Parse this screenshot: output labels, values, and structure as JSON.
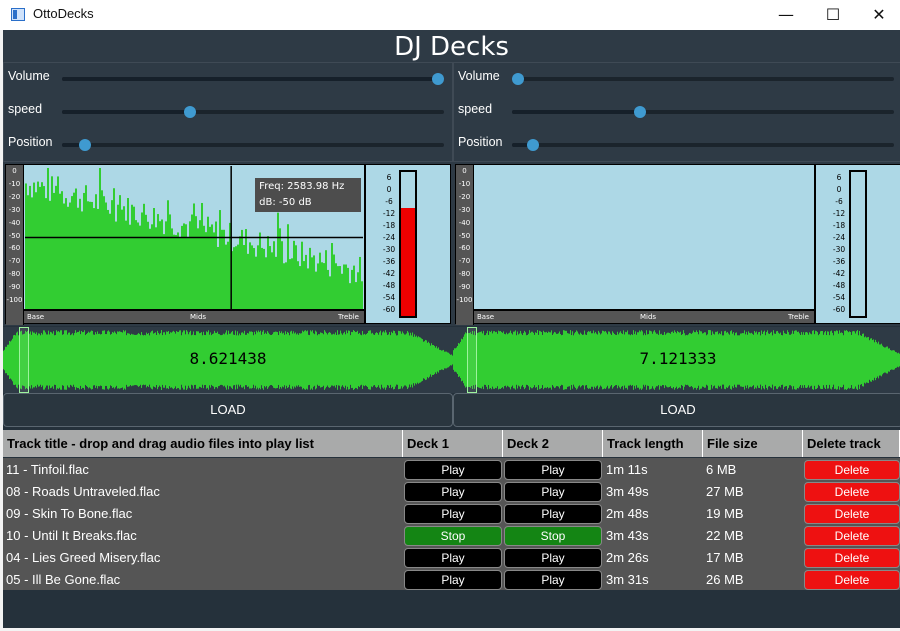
{
  "window": {
    "title": "OttoDecks",
    "minimize": "—",
    "maximize": "☐",
    "close": "✕"
  },
  "header": {
    "title": "DJ Decks"
  },
  "colors": {
    "background": "#25313b",
    "panel": "#2e3a45",
    "accent": "#3f9ad0",
    "waveform": "#32cd32",
    "spectrum_bg": "#add8e6",
    "meter": "#ee0000",
    "delete": "#ee1111",
    "stop": "#148514",
    "play": "#000000"
  },
  "deck_left": {
    "controls": [
      {
        "label": "Volume",
        "value": 1.0
      },
      {
        "label": "speed",
        "value": 0.33
      },
      {
        "label": "Position",
        "value": 0.045
      }
    ],
    "spectrum": {
      "db_ticks": [
        "0",
        "-10",
        "-20",
        "-30",
        "-40",
        "-50",
        "-60",
        "-70",
        "-80",
        "-90",
        "-100"
      ],
      "freq_labels": [
        "Base",
        "Mids",
        "Treble"
      ],
      "tooltip_freq": "Freq: 2583.98 Hz",
      "tooltip_db": "dB: -50 dB",
      "cursor": {
        "freq_fraction": 0.61,
        "db": -50
      },
      "show_bars": true
    },
    "meter": {
      "ticks": [
        "6",
        "0",
        "-6",
        "-12",
        "-18",
        "-24",
        "-30",
        "-36",
        "-42",
        "-48",
        "-54",
        "-60"
      ],
      "level_fraction": 0.75
    },
    "waveform": {
      "time": "8.621438",
      "position_fraction": 0.045
    },
    "load_label": "LOAD"
  },
  "deck_right": {
    "controls": [
      {
        "label": "Volume",
        "value": 0.0
      },
      {
        "label": "speed",
        "value": 0.33
      },
      {
        "label": "Position",
        "value": 0.04
      }
    ],
    "spectrum": {
      "db_ticks": [
        "0",
        "-10",
        "-20",
        "-30",
        "-40",
        "-50",
        "-60",
        "-70",
        "-80",
        "-90",
        "-100"
      ],
      "freq_labels": [
        "Base",
        "Mids",
        "Treble"
      ],
      "show_bars": false
    },
    "meter": {
      "ticks": [
        "6",
        "0",
        "-6",
        "-12",
        "-18",
        "-24",
        "-30",
        "-36",
        "-42",
        "-48",
        "-54",
        "-60"
      ],
      "level_fraction": 0.0
    },
    "waveform": {
      "time": "7.121333",
      "position_fraction": 0.04
    },
    "load_label": "LOAD"
  },
  "playlist": {
    "headers": [
      "Track title - drop and drag audio files into play list",
      "Deck 1",
      "Deck 2",
      "Track length",
      "File size",
      "Delete track"
    ],
    "rows": [
      {
        "title": "11 - Tinfoil.flac",
        "deck1": "Play",
        "deck2": "Play",
        "length": "1m 11s",
        "size": "6 MB",
        "delete": "Delete"
      },
      {
        "title": "08 - Roads Untraveled.flac",
        "deck1": "Play",
        "deck2": "Play",
        "length": "3m 49s",
        "size": "27 MB",
        "delete": "Delete"
      },
      {
        "title": "09 - Skin To Bone.flac",
        "deck1": "Play",
        "deck2": "Play",
        "length": "2m 48s",
        "size": "19 MB",
        "delete": "Delete"
      },
      {
        "title": "10 - Until It Breaks.flac",
        "deck1": "Stop",
        "deck2": "Stop",
        "length": "3m 43s",
        "size": "22 MB",
        "delete": "Delete"
      },
      {
        "title": "04 - Lies Greed Misery.flac",
        "deck1": "Play",
        "deck2": "Play",
        "length": "2m 26s",
        "size": "17 MB",
        "delete": "Delete"
      },
      {
        "title": "05 - Ill Be Gone.flac",
        "deck1": "Play",
        "deck2": "Play",
        "length": "3m 31s",
        "size": "26 MB",
        "delete": "Delete"
      }
    ]
  }
}
